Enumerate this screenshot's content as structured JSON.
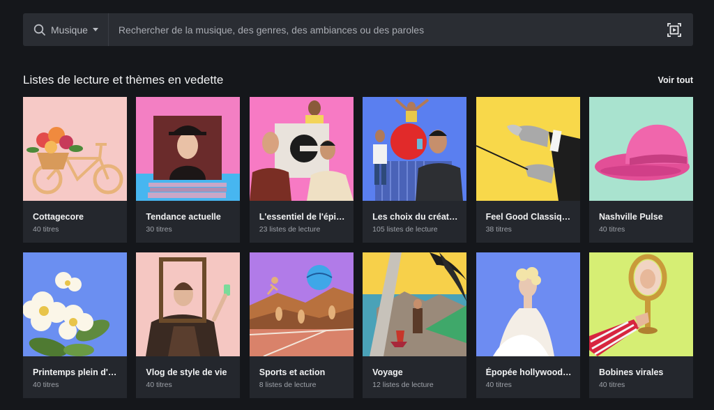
{
  "search": {
    "category": "Musique",
    "placeholder": "Rechercher de la musique, des genres, des ambiances ou des paroles"
  },
  "section": {
    "title": "Listes de lecture et thèmes en vedette",
    "see_all": "Voir tout"
  },
  "cards": [
    {
      "title": "Cottagecore",
      "subtitle": "40 titres",
      "bg": "#f6c9c6"
    },
    {
      "title": "Tendance actuelle",
      "subtitle": "30 titres",
      "bg": "#f37fc3"
    },
    {
      "title": "L'essentiel de l'épid…",
      "subtitle": "23 listes de lecture",
      "bg": "#f77ac4"
    },
    {
      "title": "Les choix du créateur",
      "subtitle": "105 listes de lecture",
      "bg": "#5a7ff0"
    },
    {
      "title": "Feel Good Classique",
      "subtitle": "38 titres",
      "bg": "#f8d84a"
    },
    {
      "title": "Nashville Pulse",
      "subtitle": "40 titres",
      "bg": "#a9e3cf"
    },
    {
      "title": "Printemps plein d'e…",
      "subtitle": "40 titres",
      "bg": "#6b8ff1"
    },
    {
      "title": "Vlog de style de vie",
      "subtitle": "40 titres",
      "bg": "#f5c7c2"
    },
    {
      "title": "Sports et action",
      "subtitle": "8 listes de lecture",
      "bg": "#b17be8"
    },
    {
      "title": "Voyage",
      "subtitle": "12 listes de lecture",
      "bg": "#f7d04a"
    },
    {
      "title": "Épopée hollywoodi…",
      "subtitle": "40 titres",
      "bg": "#6d8cf2"
    },
    {
      "title": "Bobines virales",
      "subtitle": "40 titres",
      "bg": "#d6ee74"
    }
  ]
}
